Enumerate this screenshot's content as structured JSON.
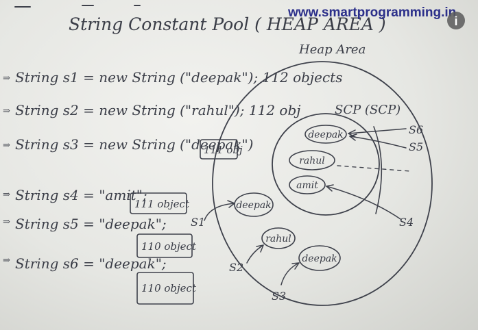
{
  "title": "String Constant Pool ( HEAP AREA )",
  "watermark": "www.smartprogramming.in",
  "info_icon": "info-icon",
  "statements": [
    {
      "text": "String s1 = new String (\"deepak\"); 112 objects",
      "suffix": ""
    },
    {
      "text": "String s2 = new String (\"rahul\"); 112 obj",
      "suffix": ""
    },
    {
      "text": "String s3 = new String (\"deepak\")",
      "suffix": "111 obj"
    },
    {
      "text": "String s4 = \"amit\";",
      "suffix": "111 object"
    },
    {
      "text": "String s5 = \"deepak\";",
      "suffix": "110 object"
    },
    {
      "text": "String s6 = \"deepak\";",
      "suffix": "110 object"
    }
  ],
  "diagram": {
    "heap_label": "Heap Area",
    "scp_label": "SCP (SCP)",
    "scp_objects": [
      "deepak",
      "rahul",
      "amit"
    ],
    "heap_objects": [
      "deepak",
      "rahul",
      "deepak"
    ],
    "refs": [
      "S6",
      "S5",
      "S4",
      "S1",
      "S2",
      "S3"
    ]
  },
  "colors": {
    "ink": "#3e414b",
    "board": "#e8e9e5",
    "watermark": "#2b2f8a"
  }
}
